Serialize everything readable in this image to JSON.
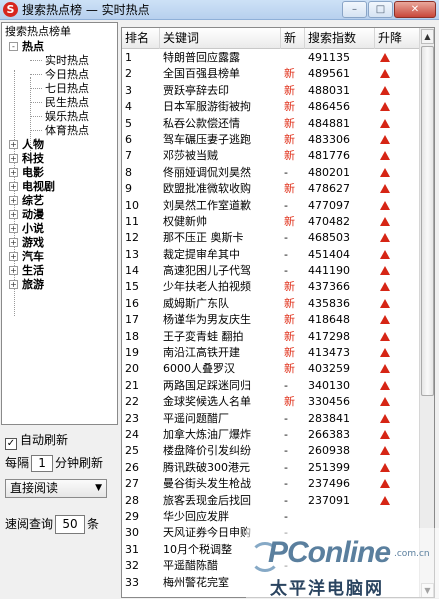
{
  "window": {
    "title": "搜索热点榜 — 实时热点",
    "icon_letter": "S",
    "controls": {
      "minimize": "–",
      "maximize": "□",
      "close": "✕"
    }
  },
  "sidebar": {
    "header": "搜索热点榜单",
    "tree": [
      {
        "label": "热点",
        "expander": "-",
        "children": [
          "实时热点",
          "今日热点",
          "七日热点",
          "民生热点",
          "娱乐热点",
          "体育热点"
        ]
      },
      {
        "label": "人物",
        "expander": "+"
      },
      {
        "label": "科技",
        "expander": "+"
      },
      {
        "label": "电影",
        "expander": "+"
      },
      {
        "label": "电视剧",
        "expander": "+"
      },
      {
        "label": "综艺",
        "expander": "+"
      },
      {
        "label": "动漫",
        "expander": "+"
      },
      {
        "label": "小说",
        "expander": "+"
      },
      {
        "label": "游戏",
        "expander": "+"
      },
      {
        "label": "汽车",
        "expander": "+"
      },
      {
        "label": "生活",
        "expander": "+"
      },
      {
        "label": "旅游",
        "expander": "+"
      }
    ]
  },
  "controls": {
    "auto_refresh_label": "自动刷新",
    "auto_refresh_checked": "✓",
    "interval_prefix": "每隔",
    "interval_value": "1",
    "interval_suffix": "分钟刷新",
    "read_mode": "直接阅读",
    "read_mode_arrow": "▼",
    "quick_prefix": "速阅查询",
    "quick_value": "50",
    "quick_suffix": "条"
  },
  "table": {
    "headers": {
      "rank": "排名",
      "keyword": "关键词",
      "new": "新",
      "index": "搜索指数",
      "trend": "升降"
    },
    "rows": [
      {
        "rank": "1",
        "keyword": "特朗普回应露露",
        "new": "",
        "index": "491135"
      },
      {
        "rank": "2",
        "keyword": "全国百强县榜单",
        "new": "新",
        "index": "489561"
      },
      {
        "rank": "3",
        "keyword": "贾跃亭辞去印",
        "new": "新",
        "index": "488031"
      },
      {
        "rank": "4",
        "keyword": "日本军服游街被拘",
        "new": "新",
        "index": "486456"
      },
      {
        "rank": "5",
        "keyword": "私吞公款偿还情",
        "new": "新",
        "index": "484881"
      },
      {
        "rank": "6",
        "keyword": "驾车碾压妻子逃跑",
        "new": "新",
        "index": "483306"
      },
      {
        "rank": "7",
        "keyword": "邓莎被当贼",
        "new": "新",
        "index": "481776"
      },
      {
        "rank": "8",
        "keyword": "佟丽娅调侃刘昊然",
        "new": "-",
        "index": "480201"
      },
      {
        "rank": "9",
        "keyword": "欧盟批准微软收购",
        "new": "新",
        "index": "478627"
      },
      {
        "rank": "10",
        "keyword": "刘昊然工作室道歉",
        "new": "-",
        "index": "477097"
      },
      {
        "rank": "11",
        "keyword": "权健新帅",
        "new": "新",
        "index": "470482"
      },
      {
        "rank": "12",
        "keyword": "那不压正 奥斯卡",
        "new": "-",
        "index": "468503"
      },
      {
        "rank": "13",
        "keyword": "裁定提审牟其中",
        "new": "-",
        "index": "451404"
      },
      {
        "rank": "14",
        "keyword": "高速犯困儿子代驾",
        "new": "-",
        "index": "441190"
      },
      {
        "rank": "15",
        "keyword": "少年扶老人拍视频",
        "new": "新",
        "index": "437366"
      },
      {
        "rank": "16",
        "keyword": "威姆斯广东队",
        "new": "新",
        "index": "435836"
      },
      {
        "rank": "17",
        "keyword": "杨谨华为男友庆生",
        "new": "新",
        "index": "418648"
      },
      {
        "rank": "18",
        "keyword": "王子変青蛙 翻拍",
        "new": "新",
        "index": "417298"
      },
      {
        "rank": "19",
        "keyword": "南沿江高铁开建",
        "new": "新",
        "index": "413473"
      },
      {
        "rank": "20",
        "keyword": "6000人叠罗汉",
        "new": "新",
        "index": "403259"
      },
      {
        "rank": "21",
        "keyword": "两路国足踩迷同归",
        "new": "-",
        "index": "340130"
      },
      {
        "rank": "22",
        "keyword": "金球奖候选人名单",
        "new": "新",
        "index": "330456"
      },
      {
        "rank": "23",
        "keyword": "平遥问题醋厂",
        "new": "-",
        "index": "283841"
      },
      {
        "rank": "24",
        "keyword": "加拿大炼油厂爆炸",
        "new": "-",
        "index": "266383"
      },
      {
        "rank": "25",
        "keyword": "楼盘降价引发纠纷",
        "new": "-",
        "index": "260938"
      },
      {
        "rank": "26",
        "keyword": "腾讯跌破300港元",
        "new": "-",
        "index": "251399"
      },
      {
        "rank": "27",
        "keyword": "曼谷街头发生枪战",
        "new": "-",
        "index": "237496"
      },
      {
        "rank": "28",
        "keyword": "旅客丢现金后找回",
        "new": "-",
        "index": "237091"
      },
      {
        "rank": "29",
        "keyword": "华少回应发胖",
        "new": "-",
        "index": ""
      },
      {
        "rank": "30",
        "keyword": "天风证券今日申购",
        "new": "-",
        "index": ""
      },
      {
        "rank": "31",
        "keyword": "10月个税调整",
        "new": "-",
        "index": ""
      },
      {
        "rank": "32",
        "keyword": "平遥醋陈醋",
        "new": "-",
        "index": ""
      },
      {
        "rank": "33",
        "keyword": "梅州警花完室",
        "new": "",
        "index": ""
      }
    ]
  },
  "scrollbar": {
    "up": "▲",
    "down": "▼"
  },
  "watermark": {
    "brand": "PConline",
    "domain": ".com.cn",
    "chinese": "太平洋电脑网"
  },
  "colors": {
    "accent_red": "#d62515",
    "new_red": "#e0311b",
    "titlebar": "#cde1f6"
  }
}
